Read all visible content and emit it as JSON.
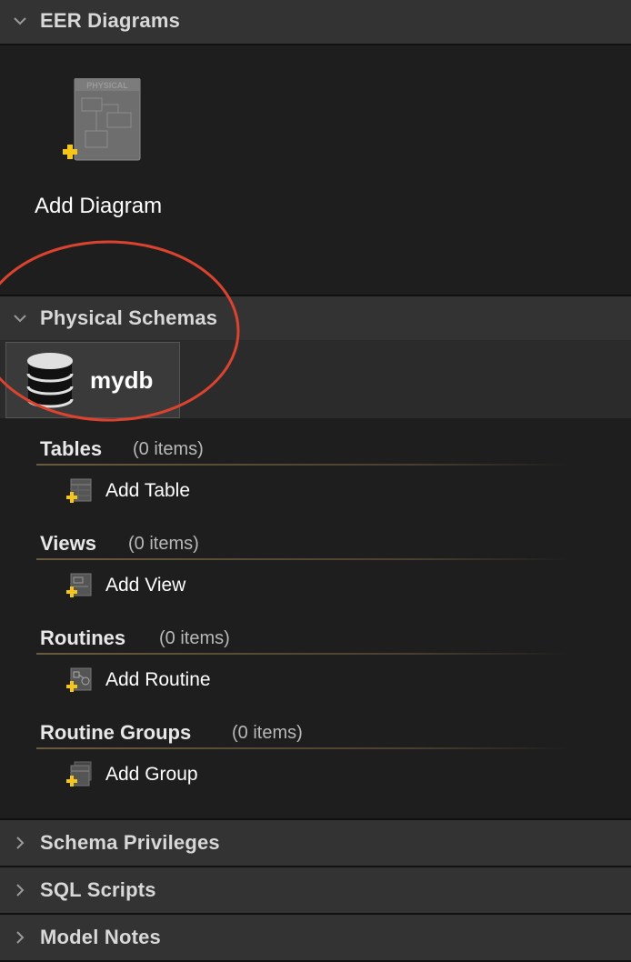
{
  "sections": {
    "eer": {
      "title": "EER Diagrams",
      "expanded": true
    },
    "physical": {
      "title": "Physical Schemas",
      "expanded": true
    },
    "privileges": {
      "title": "Schema Privileges",
      "expanded": false
    },
    "scripts": {
      "title": "SQL Scripts",
      "expanded": false
    },
    "notes": {
      "title": "Model Notes",
      "expanded": false
    }
  },
  "eer_diagrams": {
    "add_label": "Add Diagram",
    "icon_text": "PHYSICAL",
    "icon": "add-diagram-icon"
  },
  "schema_tab": {
    "name": "mydb",
    "icon": "database-icon"
  },
  "groups": {
    "tables": {
      "title": "Tables",
      "count": "(0 items)",
      "add_label": "Add Table",
      "icon": "add-table-icon"
    },
    "views": {
      "title": "Views",
      "count": "(0 items)",
      "add_label": "Add View",
      "icon": "add-view-icon"
    },
    "routines": {
      "title": "Routines",
      "count": "(0 items)",
      "add_label": "Add Routine",
      "icon": "add-routine-icon"
    },
    "routine_groups": {
      "title": "Routine Groups",
      "count": "(0 items)",
      "add_label": "Add Group",
      "icon": "add-group-icon"
    }
  },
  "colors": {
    "background": "#1e1e1e",
    "header": "#333333",
    "annotation": "#d9432f",
    "plus_badge": "#f5c518"
  }
}
